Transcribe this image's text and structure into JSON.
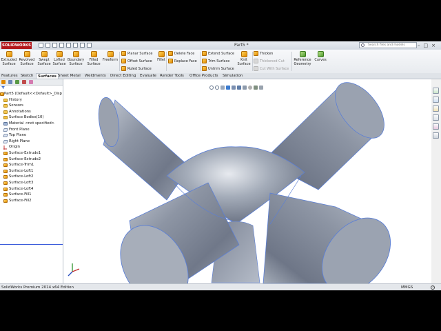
{
  "app": {
    "logo_text": "SOLIDWORKS",
    "document_title": "Part5 *",
    "search_placeholder": "Search files and models",
    "window_controls": [
      "minimize-icon",
      "restore-icon",
      "close-icon"
    ]
  },
  "ribbon": {
    "large_buttons": [
      {
        "label1": "Extruded",
        "label2": "Surface",
        "icon": "extruded-surface-icon"
      },
      {
        "label1": "Revolved",
        "label2": "Surface",
        "icon": "revolved-surface-icon"
      },
      {
        "label1": "Swept",
        "label2": "Surface",
        "icon": "swept-surface-icon"
      },
      {
        "label1": "Lofted",
        "label2": "Surface",
        "icon": "lofted-surface-icon"
      },
      {
        "label1": "Boundary",
        "label2": "Surface",
        "icon": "boundary-surface-icon"
      },
      {
        "label1": "Filled",
        "label2": "Surface",
        "icon": "filled-surface-icon"
      },
      {
        "label1": "Freeform",
        "label2": "",
        "icon": "freeform-icon"
      }
    ],
    "group2": [
      {
        "label": "Planar Surface",
        "icon": "planar-surface-icon"
      },
      {
        "label": "Offset Surface",
        "icon": "offset-surface-icon"
      },
      {
        "label": "Ruled Surface",
        "icon": "ruled-surface-icon"
      }
    ],
    "fillet": {
      "label": "Fillet",
      "icon": "fillet-icon"
    },
    "group3": [
      {
        "label": "Delete Face",
        "icon": "delete-face-icon"
      },
      {
        "label": "Replace Face",
        "icon": "replace-face-icon"
      }
    ],
    "group4": [
      {
        "label": "Extend Surface",
        "icon": "extend-surface-icon"
      },
      {
        "label": "Trim Surface",
        "icon": "trim-surface-icon"
      },
      {
        "label": "Untrim Surface",
        "icon": "untrim-surface-icon"
      }
    ],
    "knit": {
      "label1": "Knit",
      "label2": "Surface",
      "icon": "knit-surface-icon"
    },
    "group5": [
      {
        "label": "Thicken",
        "icon": "thicken-icon",
        "enabled": true
      },
      {
        "label": "Thickened Cut",
        "icon": "thickened-cut-icon",
        "enabled": false
      },
      {
        "label": "Cut With Surface",
        "icon": "cut-with-surface-icon",
        "enabled": false
      }
    ],
    "reference": {
      "label1": "Reference",
      "label2": "Geometry",
      "icon": "reference-geometry-icon"
    },
    "curves": {
      "label1": "Curves",
      "icon": "curves-icon"
    }
  },
  "tabs": [
    {
      "label": "Features",
      "active": false
    },
    {
      "label": "Sketch",
      "active": false
    },
    {
      "label": "Surfaces",
      "active": true
    },
    {
      "label": "Sheet Metal",
      "active": false
    },
    {
      "label": "Weldments",
      "active": false
    },
    {
      "label": "Direct Editing",
      "active": false
    },
    {
      "label": "Evaluate",
      "active": false
    },
    {
      "label": "Render Tools",
      "active": false
    },
    {
      "label": "Office Products",
      "active": false
    },
    {
      "label": "Simulation",
      "active": false
    }
  ],
  "tree": {
    "root": "Part5  (Default<<Default>_Disp",
    "items": [
      {
        "label": "History",
        "icon": "history-folder-icon",
        "type": "folder"
      },
      {
        "label": "Sensors",
        "icon": "sensors-folder-icon",
        "type": "folder"
      },
      {
        "label": "Annotations",
        "icon": "annotations-folder-icon",
        "type": "folder"
      },
      {
        "label": "Surface Bodies(10)",
        "icon": "surface-bodies-folder-icon",
        "type": "folder"
      },
      {
        "label": "Material <not specified>",
        "icon": "material-icon",
        "type": "mat"
      },
      {
        "label": "Front Plane",
        "icon": "plane-icon",
        "type": "plane"
      },
      {
        "label": "Top Plane",
        "icon": "plane-icon",
        "type": "plane"
      },
      {
        "label": "Right Plane",
        "icon": "plane-icon",
        "type": "plane"
      },
      {
        "label": "Origin",
        "icon": "origin-icon",
        "type": "origin"
      },
      {
        "label": "Surface-Extrude1",
        "icon": "surface-feature-icon",
        "type": "surf"
      },
      {
        "label": "Surface-Extrude2",
        "icon": "surface-feature-icon",
        "type": "surf"
      },
      {
        "label": "Surface-Trim1",
        "icon": "surface-feature-icon",
        "type": "surf"
      },
      {
        "label": "Surface-Loft1",
        "icon": "surface-feature-icon",
        "type": "surf"
      },
      {
        "label": "Surface-Loft2",
        "icon": "surface-feature-icon",
        "type": "surf"
      },
      {
        "label": "Surface-Loft3",
        "icon": "surface-feature-icon",
        "type": "surf"
      },
      {
        "label": "Surface-Loft4",
        "icon": "surface-feature-icon",
        "type": "surf"
      },
      {
        "label": "Surface-Fill1",
        "icon": "surface-feature-icon",
        "type": "surf"
      },
      {
        "label": "Surface-Fill2",
        "icon": "surface-feature-icon",
        "type": "surf"
      }
    ]
  },
  "heads_up_toolbar": [
    "zoom-to-fit-icon",
    "zoom-to-area-icon",
    "previous-view-icon",
    "section-view-icon",
    "view-orientation-icon",
    "display-style-icon",
    "hide-show-items-icon",
    "edit-appearance-icon",
    "apply-scene-icon",
    "view-settings-icon"
  ],
  "task_pane": [
    "solidworks-resources-icon",
    "design-library-icon",
    "file-explorer-icon",
    "view-palette-icon",
    "appearances-icon",
    "custom-properties-icon"
  ],
  "colors": {
    "model_surface": "#8f97a6",
    "model_edge": "#5b7fd6",
    "accent_rule": "#3b5bdb"
  },
  "status": {
    "left": "SolidWorks Premium 2014 x64 Edition",
    "units": "MMGS",
    "help": "?"
  }
}
